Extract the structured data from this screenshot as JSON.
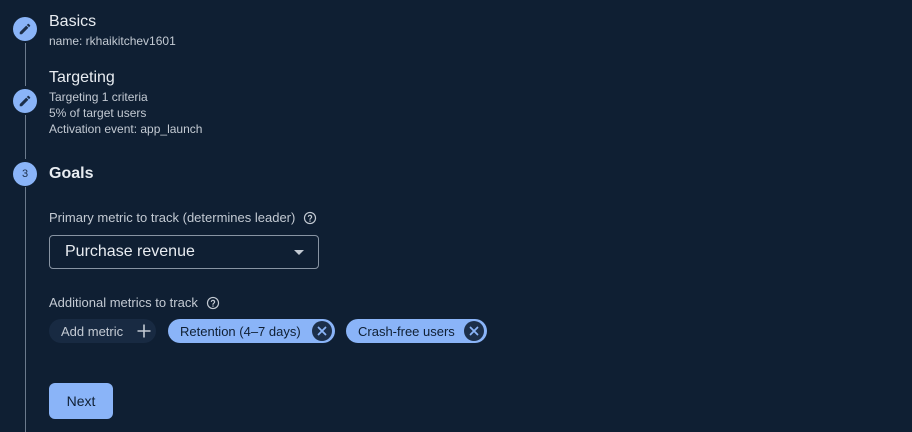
{
  "steps": {
    "basics": {
      "title": "Basics",
      "subtitle": "name: rkhaikitchev1601",
      "icon": "pencil-icon"
    },
    "targeting": {
      "title": "Targeting",
      "lines": [
        "Targeting 1 criteria",
        "5% of target users",
        "Activation event: app_launch"
      ],
      "icon": "pencil-icon"
    },
    "goals": {
      "number": "3",
      "title": "Goals"
    }
  },
  "goals": {
    "primary_label": "Primary metric to track (determines leader)",
    "primary_value": "Purchase revenue",
    "additional_label": "Additional metrics to track",
    "add_metric_label": "Add metric",
    "chips": [
      {
        "label": "Retention (4–7 days)"
      },
      {
        "label": "Crash-free users"
      }
    ]
  },
  "actions": {
    "next_label": "Next"
  },
  "colors": {
    "background": "#0f1f33",
    "accent": "#8ab4f8",
    "text": "#e8ecf1",
    "muted": "#c3cad3"
  }
}
